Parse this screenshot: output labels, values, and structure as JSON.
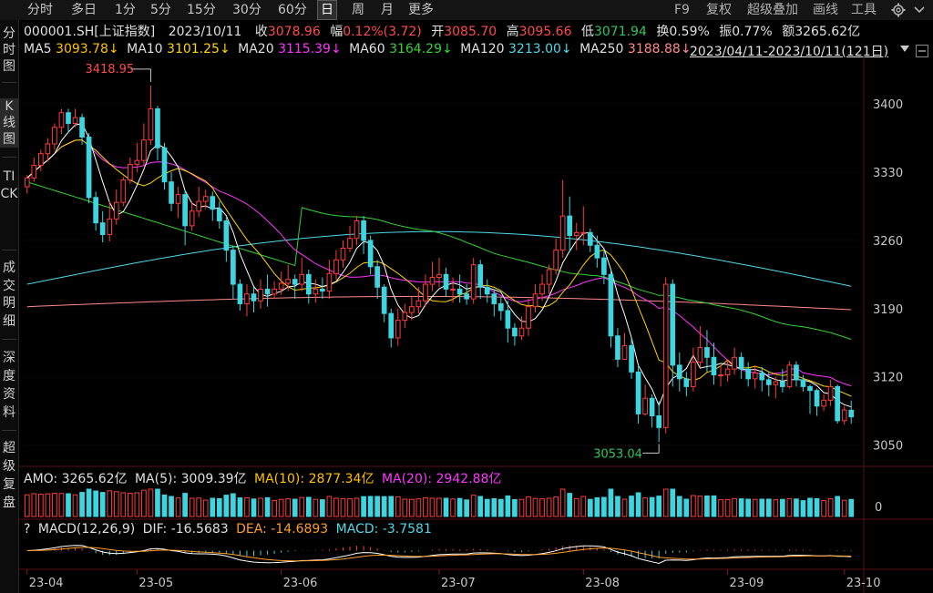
{
  "toolbar": {
    "tabs": [
      "分时",
      "多日",
      "1分",
      "5分",
      "15分",
      "30分",
      "60分",
      "日",
      "周",
      "月",
      "更多"
    ],
    "active_tab": "日",
    "right": {
      "f9": "F9",
      "fuquan": "复权",
      "overlay": "超级叠加",
      "draw": "画线",
      "tools": "工具"
    },
    "settings_icon": "gear-icon",
    "dropdown_icon": "chevron-down-icon"
  },
  "leftnav": {
    "items": [
      "分时图",
      "K线图",
      "TICK",
      "成交明细",
      "深度资料",
      "超级复盘"
    ],
    "active": "K线图"
  },
  "quote": {
    "symbol": "000001.SH[上证指数]",
    "date": "2023/10/11",
    "close_label": "收",
    "close": "3078.96",
    "change_label": "幅",
    "change": "0.12%(3.72)",
    "open_label": "开",
    "open": "3085.70",
    "high_label": "高",
    "high": "3095.66",
    "low_label": "低",
    "low": "3071.94",
    "turnover_label": "换",
    "turnover": "0.59%",
    "amplitude_label": "振",
    "amplitude": "0.77%",
    "amount_label": "额",
    "amount": "3265.62亿"
  },
  "ma_row": {
    "ma5_label": "MA5",
    "ma5": "3093.78↓",
    "ma10_label": "MA10",
    "ma10": "3101.25↓",
    "ma20_label": "MA20",
    "ma20": "3115.39↓",
    "ma60_label": "MA60",
    "ma60": "3164.29↓",
    "ma120_label": "MA120",
    "ma120": "3213.00↓",
    "ma250_label": "MA250",
    "ma250": "3188.88↓",
    "date_range": "2023/04/11-2023/10/11(121日)"
  },
  "amo_row": {
    "amo_label": "AMO:",
    "amo": "3265.62亿",
    "ma5_label": "MA(5):",
    "ma5": "3009.39亿",
    "ma10_label": "MA(10):",
    "ma10": "2877.34亿",
    "ma20_label": "MA(20):",
    "ma20": "2942.88亿",
    "zero": "0"
  },
  "macd_row": {
    "question": "?",
    "title": "MACD(12,26,9)",
    "dif_label": "DIF:",
    "dif": "-16.5683",
    "dea_label": "DEA:",
    "dea": "-14.6893",
    "macd_label": "MACD:",
    "macd": "-3.7581"
  },
  "colors": {
    "up": "#ff3b3b",
    "down": "#3dd5e0",
    "ma5": "#ffffff",
    "ma10": "#ffd400",
    "ma20": "#ff35ff",
    "ma60": "#35d135",
    "ma120": "#4fd8e8",
    "ma250": "#ff8a8a",
    "grid": "#3a0a0a"
  },
  "chart_data": {
    "type": "candlestick",
    "ylim": [
      3030,
      3430
    ],
    "yticks": [
      3050,
      3120,
      3190,
      3260,
      3330,
      3400
    ],
    "xtick_labels": [
      "23-04",
      "23-05",
      "23-06",
      "23-07",
      "23-08",
      "23-09",
      "23-10"
    ],
    "annotations": {
      "high": "3418.95",
      "low": "3053.04"
    },
    "candles": [
      [
        3315,
        3324,
        3327,
        3308
      ],
      [
        3324,
        3337,
        3345,
        3320
      ],
      [
        3337,
        3349,
        3353,
        3331
      ],
      [
        3349,
        3359,
        3365,
        3341
      ],
      [
        3359,
        3376,
        3380,
        3353
      ],
      [
        3376,
        3391,
        3395,
        3369
      ],
      [
        3391,
        3380,
        3395,
        3370
      ],
      [
        3380,
        3386,
        3395,
        3376
      ],
      [
        3386,
        3366,
        3390,
        3358
      ],
      [
        3366,
        3304,
        3370,
        3298
      ],
      [
        3304,
        3278,
        3310,
        3270
      ],
      [
        3278,
        3266,
        3290,
        3258
      ],
      [
        3266,
        3282,
        3300,
        3259
      ],
      [
        3282,
        3299,
        3312,
        3276
      ],
      [
        3299,
        3322,
        3325,
        3295
      ],
      [
        3322,
        3338,
        3345,
        3318
      ],
      [
        3338,
        3342,
        3360,
        3330
      ],
      [
        3342,
        3363,
        3380,
        3336
      ],
      [
        3363,
        3395,
        3418.95,
        3358
      ],
      [
        3395,
        3355,
        3398,
        3342
      ],
      [
        3355,
        3320,
        3360,
        3312
      ],
      [
        3320,
        3298,
        3330,
        3290
      ],
      [
        3298,
        3307,
        3315,
        3283
      ],
      [
        3307,
        3275,
        3312,
        3255
      ],
      [
        3275,
        3290,
        3300,
        3270
      ],
      [
        3290,
        3300,
        3315,
        3284
      ],
      [
        3300,
        3305,
        3312,
        3292
      ],
      [
        3305,
        3292,
        3310,
        3280
      ],
      [
        3292,
        3280,
        3300,
        3272
      ],
      [
        3280,
        3250,
        3285,
        3238
      ],
      [
        3250,
        3215,
        3255,
        3200
      ],
      [
        3215,
        3195,
        3220,
        3188
      ],
      [
        3195,
        3205,
        3215,
        3182
      ],
      [
        3205,
        3198,
        3212,
        3186
      ],
      [
        3198,
        3210,
        3220,
        3190
      ],
      [
        3210,
        3205,
        3225,
        3192
      ],
      [
        3205,
        3210,
        3218,
        3200
      ],
      [
        3210,
        3216,
        3228,
        3204
      ],
      [
        3216,
        3220,
        3235,
        3208
      ],
      [
        3220,
        3215,
        3225,
        3200
      ],
      [
        3215,
        3225,
        3242,
        3208
      ],
      [
        3225,
        3205,
        3230,
        3195
      ],
      [
        3205,
        3210,
        3220,
        3196
      ],
      [
        3210,
        3208,
        3222,
        3200
      ],
      [
        3208,
        3226,
        3240,
        3200
      ],
      [
        3226,
        3240,
        3250,
        3220
      ],
      [
        3240,
        3252,
        3260,
        3232
      ],
      [
        3252,
        3262,
        3275,
        3248
      ],
      [
        3262,
        3280,
        3285,
        3255
      ],
      [
        3280,
        3260,
        3285,
        3246
      ],
      [
        3260,
        3233,
        3265,
        3225
      ],
      [
        3233,
        3212,
        3240,
        3200
      ],
      [
        3212,
        3185,
        3215,
        3176
      ],
      [
        3185,
        3160,
        3190,
        3150
      ],
      [
        3160,
        3178,
        3190,
        3152
      ],
      [
        3178,
        3186,
        3195,
        3170
      ],
      [
        3186,
        3192,
        3202,
        3178
      ],
      [
        3192,
        3198,
        3212,
        3185
      ],
      [
        3198,
        3215,
        3225,
        3192
      ],
      [
        3215,
        3222,
        3238,
        3208
      ],
      [
        3222,
        3225,
        3242,
        3212
      ],
      [
        3225,
        3210,
        3232,
        3202
      ],
      [
        3210,
        3210,
        3222,
        3196
      ],
      [
        3210,
        3205,
        3225,
        3196
      ],
      [
        3205,
        3200,
        3215,
        3194
      ],
      [
        3200,
        3235,
        3242,
        3195
      ],
      [
        3235,
        3212,
        3240,
        3200
      ],
      [
        3212,
        3205,
        3220,
        3196
      ],
      [
        3205,
        3195,
        3210,
        3182
      ],
      [
        3195,
        3188,
        3202,
        3178
      ],
      [
        3188,
        3170,
        3198,
        3155
      ],
      [
        3170,
        3162,
        3175,
        3152
      ],
      [
        3162,
        3170,
        3182,
        3158
      ],
      [
        3170,
        3192,
        3200,
        3162
      ],
      [
        3192,
        3205,
        3215,
        3186
      ],
      [
        3205,
        3215,
        3225,
        3198
      ],
      [
        3215,
        3230,
        3235,
        3205
      ],
      [
        3230,
        3250,
        3262,
        3225
      ],
      [
        3250,
        3285,
        3322,
        3242
      ],
      [
        3285,
        3265,
        3305,
        3248
      ],
      [
        3265,
        3268,
        3278,
        3250
      ],
      [
        3268,
        3268,
        3295,
        3255
      ],
      [
        3268,
        3255,
        3272,
        3248
      ],
      [
        3255,
        3242,
        3265,
        3232
      ],
      [
        3242,
        3225,
        3250,
        3215
      ],
      [
        3225,
        3162,
        3230,
        3150
      ],
      [
        3162,
        3138,
        3170,
        3130
      ],
      [
        3138,
        3152,
        3165,
        3140
      ],
      [
        3152,
        3125,
        3160,
        3118
      ],
      [
        3125,
        3082,
        3132,
        3072
      ],
      [
        3082,
        3098,
        3112,
        3080
      ],
      [
        3098,
        3080,
        3102,
        3068
      ],
      [
        3080,
        3068,
        3095,
        3053.04
      ],
      [
        3068,
        3215,
        3222,
        3062
      ],
      [
        3215,
        3132,
        3220,
        3110
      ],
      [
        3132,
        3118,
        3145,
        3105
      ],
      [
        3118,
        3110,
        3125,
        3100
      ],
      [
        3110,
        3135,
        3150,
        3105
      ],
      [
        3135,
        3150,
        3172,
        3130
      ],
      [
        3150,
        3140,
        3168,
        3125
      ],
      [
        3140,
        3122,
        3155,
        3112
      ],
      [
        3122,
        3122,
        3132,
        3110
      ],
      [
        3122,
        3128,
        3138,
        3115
      ],
      [
        3128,
        3140,
        3150,
        3122
      ],
      [
        3140,
        3128,
        3145,
        3118
      ],
      [
        3128,
        3118,
        3135,
        3110
      ],
      [
        3118,
        3124,
        3132,
        3108
      ],
      [
        3124,
        3117,
        3130,
        3105
      ],
      [
        3117,
        3112,
        3125,
        3100
      ],
      [
        3112,
        3115,
        3120,
        3098
      ],
      [
        3115,
        3110,
        3128,
        3104
      ],
      [
        3110,
        3132,
        3136,
        3108
      ],
      [
        3132,
        3117,
        3136,
        3110
      ],
      [
        3117,
        3110,
        3122,
        3105
      ],
      [
        3110,
        3106,
        3112,
        3082
      ],
      [
        3106,
        3090,
        3108,
        3080
      ],
      [
        3090,
        3096,
        3102,
        3085
      ],
      [
        3096,
        3110,
        3117,
        3090
      ],
      [
        3110,
        3075,
        3112,
        3072
      ],
      [
        3075,
        3086,
        3090,
        3071
      ],
      [
        3085.7,
        3078.96,
        3095.66,
        3071.94
      ]
    ]
  }
}
